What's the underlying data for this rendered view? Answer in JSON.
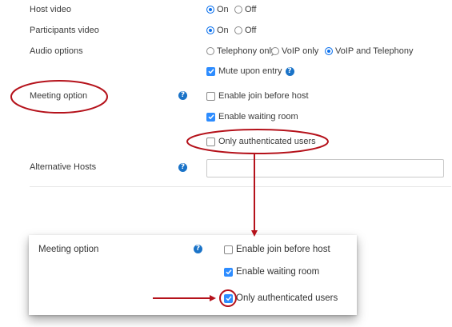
{
  "settings": {
    "host_video": {
      "label": "Host video",
      "on": "On",
      "off": "Off",
      "selected": "On"
    },
    "participants_video": {
      "label": "Participants video",
      "on": "On",
      "off": "Off",
      "selected": "On"
    },
    "audio_options": {
      "label": "Audio options",
      "telephony_only": "Telephony only",
      "voip_only": "VoIP only",
      "voip_and_telephony": "VoIP and Telephony",
      "selected": "VoIP and Telephony",
      "mute_upon_entry": "Mute upon entry"
    },
    "meeting_option": {
      "label": "Meeting option",
      "enable_join_before_host": "Enable join before host",
      "enable_waiting_room": "Enable waiting room",
      "only_authenticated_users": "Only authenticated users"
    },
    "alternative_hosts": {
      "label": "Alternative Hosts",
      "value": ""
    }
  },
  "zoomed": {
    "label": "Meeting option",
    "enable_join_before_host": "Enable join before host",
    "enable_waiting_room": "Enable waiting room",
    "only_authenticated_users": "Only authenticated users"
  },
  "colors": {
    "annotation_red": "#b5121b",
    "accent_blue": "#2d8cff",
    "help_blue": "#1a73c8"
  }
}
